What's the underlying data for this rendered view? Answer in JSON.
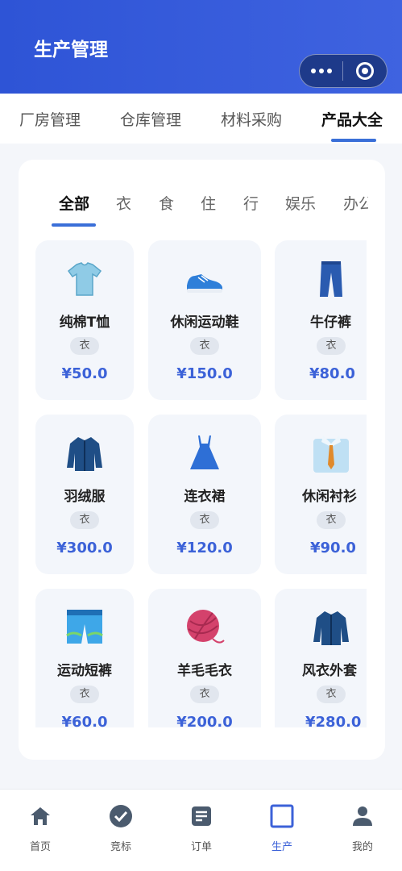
{
  "header": {
    "title": "生产管理"
  },
  "capsule": {
    "more_icon": "more-dots-icon",
    "close_icon": "target-circle-icon"
  },
  "top_tabs": [
    {
      "label": "厂房管理",
      "active": false
    },
    {
      "label": "仓库管理",
      "active": false
    },
    {
      "label": "材料采购",
      "active": false
    },
    {
      "label": "产品大全",
      "active": true
    }
  ],
  "category_tabs": [
    {
      "label": "全部",
      "active": true
    },
    {
      "label": "衣",
      "active": false
    },
    {
      "label": "食",
      "active": false
    },
    {
      "label": "住",
      "active": false
    },
    {
      "label": "行",
      "active": false
    },
    {
      "label": "娱乐",
      "active": false
    },
    {
      "label": "办公",
      "active": false
    }
  ],
  "products": [
    {
      "name": "纯棉T恤",
      "tag": "衣",
      "price": "¥50.0",
      "icon": "tshirt-icon"
    },
    {
      "name": "休闲运动鞋",
      "tag": "衣",
      "price": "¥150.0",
      "icon": "sneaker-icon"
    },
    {
      "name": "牛仔裤",
      "tag": "衣",
      "price": "¥80.0",
      "icon": "jeans-icon"
    },
    {
      "name": "羽绒服",
      "tag": "衣",
      "price": "¥300.0",
      "icon": "coat-icon"
    },
    {
      "name": "连衣裙",
      "tag": "衣",
      "price": "¥120.0",
      "icon": "dress-icon"
    },
    {
      "name": "休闲衬衫",
      "tag": "衣",
      "price": "¥90.0",
      "icon": "shirt-tie-icon"
    },
    {
      "name": "运动短裤",
      "tag": "衣",
      "price": "¥60.0",
      "icon": "shorts-icon"
    },
    {
      "name": "羊毛毛衣",
      "tag": "衣",
      "price": "¥200.0",
      "icon": "yarn-ball-icon"
    },
    {
      "name": "风衣外套",
      "tag": "衣",
      "price": "¥280.0",
      "icon": "coat-icon"
    }
  ],
  "bottom_nav": [
    {
      "label": "首页",
      "icon": "home-icon",
      "active": false
    },
    {
      "label": "竞标",
      "icon": "check-circle-icon",
      "active": false
    },
    {
      "label": "订单",
      "icon": "document-icon",
      "active": false
    },
    {
      "label": "生产",
      "icon": "square-outline-icon",
      "active": true
    },
    {
      "label": "我的",
      "icon": "user-icon",
      "active": false
    }
  ],
  "colors": {
    "header": "#2e54d6",
    "accent": "#3c62d8",
    "background": "#f4f6fa"
  }
}
